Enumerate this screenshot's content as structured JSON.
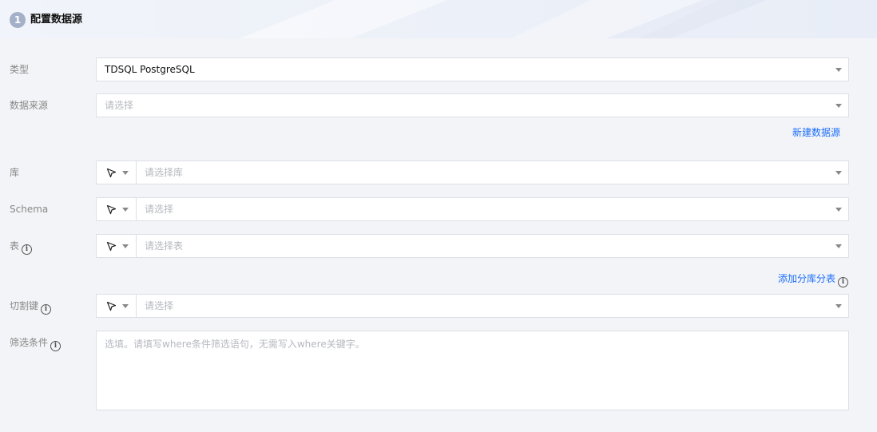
{
  "section": {
    "step_number": "1",
    "title": "配置数据源"
  },
  "form": {
    "type": {
      "label": "类型",
      "value": "TDSQL PostgreSQL"
    },
    "datasource": {
      "label": "数据来源",
      "placeholder": "请选择"
    },
    "new_datasource_link": "新建数据源",
    "database": {
      "label": "库",
      "placeholder": "请选择库"
    },
    "schema": {
      "label": "Schema",
      "placeholder": "请选择"
    },
    "table": {
      "label": "表",
      "placeholder": "请选择表"
    },
    "add_shard_link": "添加分库分表",
    "split_key": {
      "label": "切割键",
      "placeholder": "请选择"
    },
    "filter": {
      "label": "筛选条件",
      "placeholder": "选填。请填写where条件筛选语句，无需写入where关键字。"
    }
  },
  "icons": {
    "info": "info-circle-icon",
    "mode": "cursor-pointer-icon",
    "dropdown": "caret-down-icon"
  },
  "colors": {
    "link": "#1a6dfd",
    "step_badge": "#a3b0c8"
  }
}
